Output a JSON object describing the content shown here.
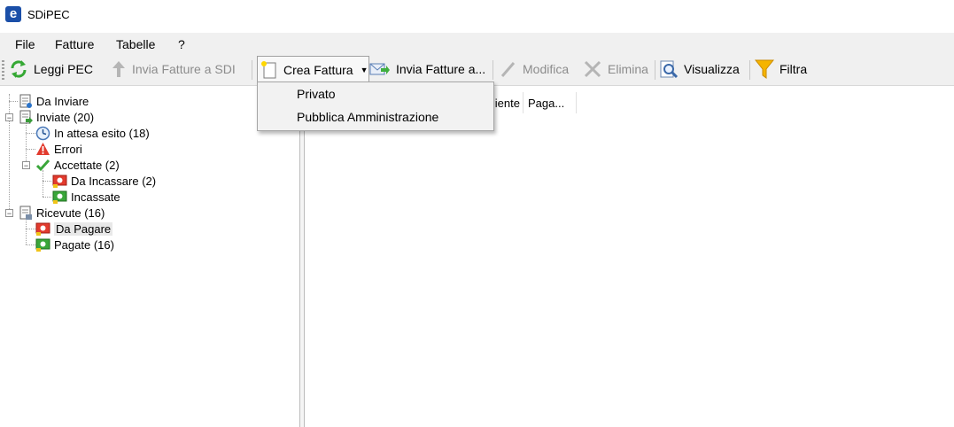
{
  "window": {
    "title": "SDiPEC",
    "app_icon_letter": "e"
  },
  "menu": [
    "File",
    "Fatture",
    "Tabelle",
    "?"
  ],
  "toolbar": {
    "leggi_pec": "Leggi PEC",
    "invia_sdi": "Invia Fatture a SDI",
    "crea_fattura": "Crea Fattura",
    "invia_fatture": "Invia Fatture a...",
    "modifica": "Modifica",
    "elimina": "Elimina",
    "visualizza": "Visualizza",
    "filtra": "Filtra"
  },
  "crea_menu": [
    "Privato",
    "Pubblica Amministrazione"
  ],
  "tree": [
    {
      "label": "Da Inviare",
      "icon": "document-icon"
    },
    {
      "label": "Inviate (20)",
      "icon": "document-sent-icon",
      "expanded": true
    },
    {
      "label": "In attesa esito (18)",
      "icon": "clock-icon"
    },
    {
      "label": "Errori",
      "icon": "warning-icon"
    },
    {
      "label": "Accettate (2)",
      "icon": "checkmark-icon",
      "expanded": true
    },
    {
      "label": "Da Incassare (2)",
      "icon": "money-red-icon"
    },
    {
      "label": "Incassate",
      "icon": "money-green-icon"
    },
    {
      "label": "Ricevute (16)",
      "icon": "document-received-icon",
      "expanded": true
    },
    {
      "label": "Da Pagare",
      "icon": "money-red-icon",
      "selected": true
    },
    {
      "label": "Pagate (16)",
      "icon": "money-green-icon"
    }
  ],
  "grid_columns": [
    "iente",
    "Paga..."
  ],
  "colors": {
    "toolbar_bg": "#f0f0f0",
    "accent_blue": "#1b4fa8"
  }
}
